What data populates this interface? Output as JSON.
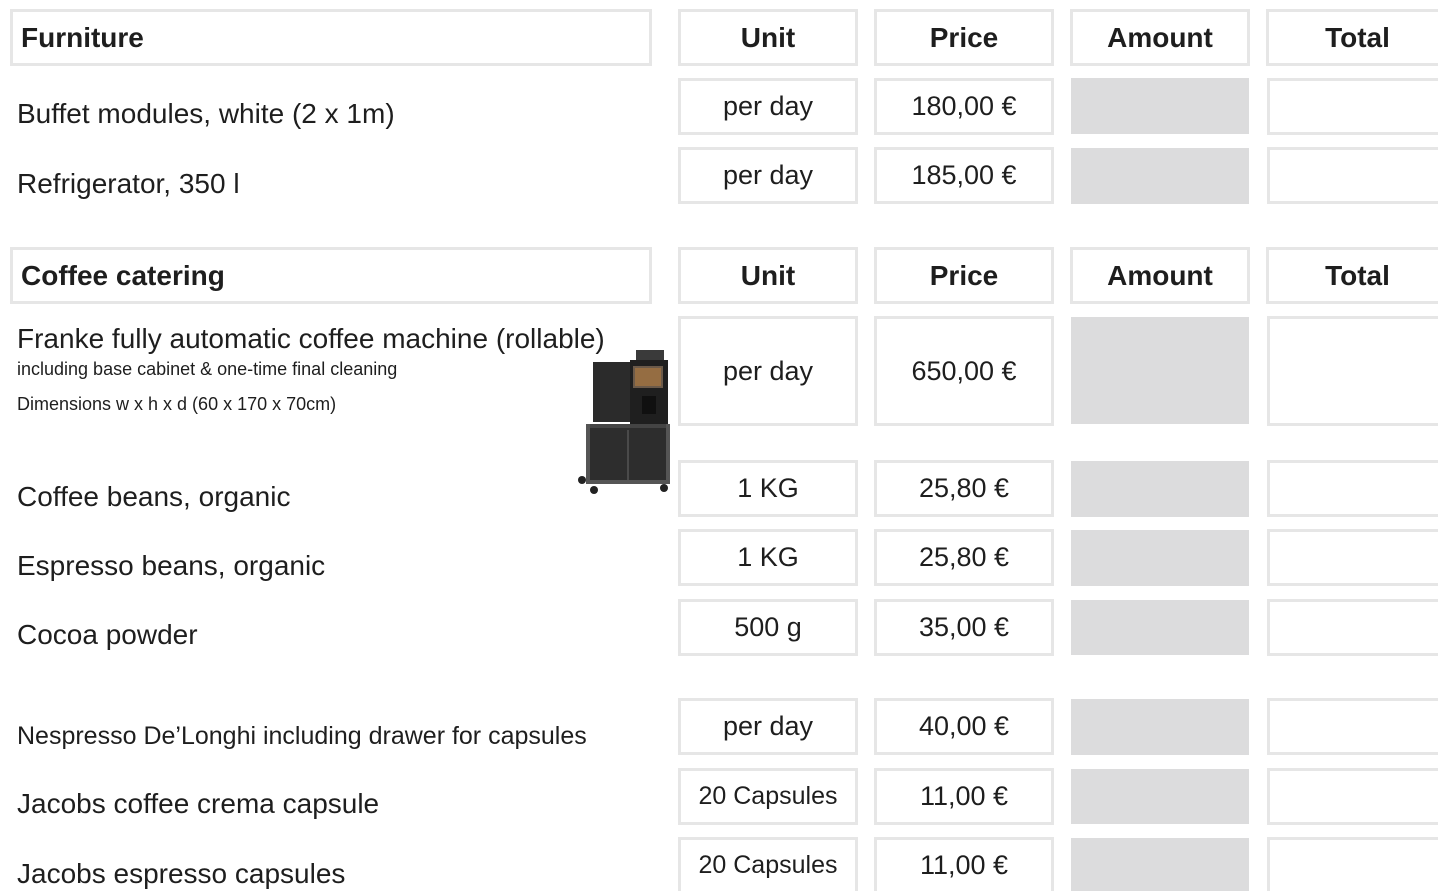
{
  "columns": {
    "unit": "Unit",
    "price": "Price",
    "amount": "Amount",
    "total": "Total"
  },
  "sections": [
    {
      "title": "Furniture",
      "items": [
        {
          "name": "Buffet modules, white (2 x 1m)",
          "unit": "per day",
          "price": "180,00 €"
        },
        {
          "name": "Refrigerator, 350 l",
          "unit": "per day",
          "price": "185,00 €"
        }
      ]
    },
    {
      "title": "Coffee catering",
      "items": [
        {
          "name": "Franke fully automatic coffee machine (rollable)",
          "details": [
            "including base cabinet & one-time final cleaning",
            "Dimensions w x h x d (60 x 170 x 70cm)"
          ],
          "unit": "per day",
          "price": "650,00 €",
          "image": "coffee-machine"
        },
        {
          "name": "Coffee beans, organic",
          "unit": "1 KG",
          "price": "25,80 €"
        },
        {
          "name": "Espresso beans, organic",
          "unit": "1 KG",
          "price": "25,80 €"
        },
        {
          "name": "Cocoa powder",
          "unit": "500 g",
          "price": "35,00 €"
        },
        {
          "name": "Nespresso De’Longhi including drawer for capsules",
          "unit": "per day",
          "price": "40,00 €"
        },
        {
          "name": "Jacobs coffee crema capsule",
          "unit": "20 Capsules",
          "price": "11,00 €"
        },
        {
          "name": "Jacobs espresso capsules",
          "unit": "20 Capsules",
          "price": "11,00 €"
        }
      ]
    }
  ]
}
